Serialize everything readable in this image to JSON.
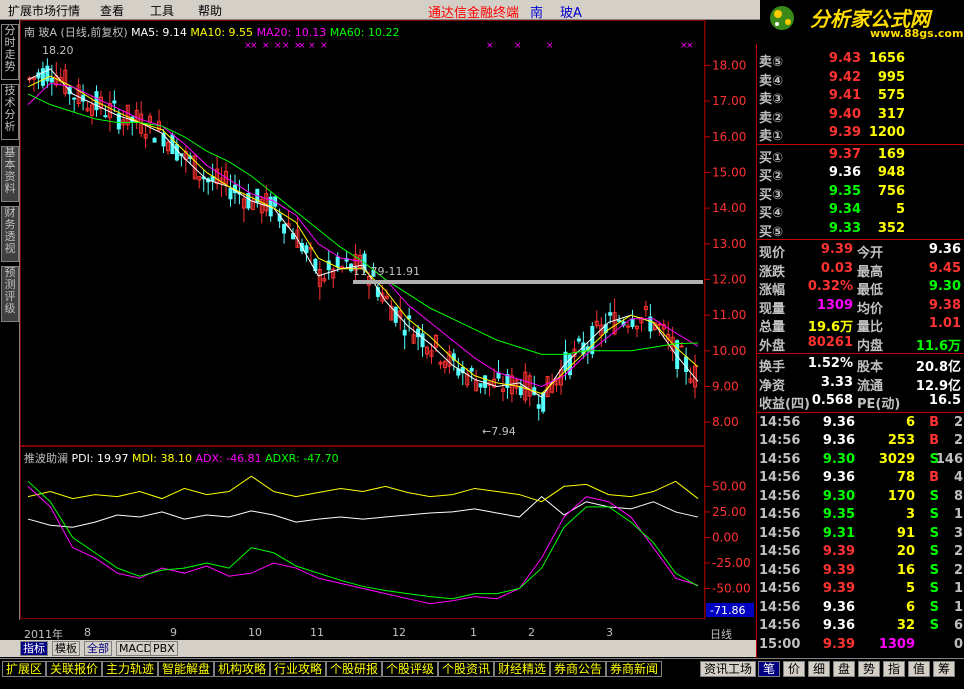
{
  "menu": {
    "items": [
      "扩展市场行情",
      "查看",
      "工具",
      "帮助"
    ],
    "title": "通达信金融终端",
    "stock_short": "南",
    "stock_name": "玻A"
  },
  "logo": {
    "text": "分析家公式网",
    "url": "www.88gs.com"
  },
  "left_tabs": [
    "分时走势",
    "技术分析",
    "基本资料",
    "财务透视",
    "预测评级"
  ],
  "main_header": {
    "stock": "南  玻A",
    "period": "(日线,前复权)",
    "ma5": "MA5: 9.14",
    "ma10": "MA10: 9.55",
    "ma20": "MA20: 10.13",
    "ma60": "MA60: 10.22",
    "high_mark": "18.20",
    "low_mark": "7.94",
    "range_label": "11.79-11.91"
  },
  "price_axis": [
    "18.00",
    "17.00",
    "16.00",
    "15.00",
    "14.00",
    "13.00",
    "12.00",
    "11.00",
    "10.00",
    "9.00",
    "8.00"
  ],
  "ind_header": {
    "name": "推波助澜",
    "pdi": "PDI: 19.97",
    "mdi": "MDI: 38.10",
    "adx": "ADX: -46.81",
    "adxr": "ADXR: -47.70"
  },
  "ind_axis": [
    "50.00",
    "25.00",
    "0.00",
    "-25.00",
    "-50.00"
  ],
  "ind_current": "-71.86",
  "date_axis": [
    "2011年",
    "8",
    "9",
    "10",
    "11",
    "12",
    "1",
    "2",
    "3"
  ],
  "period_button": "日线",
  "bottom_tabs": [
    "指标",
    "模板",
    "全部",
    "MACD",
    "PBX"
  ],
  "quotes": {
    "asks": [
      {
        "label": "卖⑤",
        "price": "9.43",
        "vol": "1656"
      },
      {
        "label": "卖④",
        "price": "9.42",
        "vol": "995"
      },
      {
        "label": "卖③",
        "price": "9.41",
        "vol": "575"
      },
      {
        "label": "卖②",
        "price": "9.40",
        "vol": "317"
      },
      {
        "label": "卖①",
        "price": "9.39",
        "vol": "1200"
      }
    ],
    "bids": [
      {
        "label": "买①",
        "price": "9.37",
        "vol": "169"
      },
      {
        "label": "买②",
        "price": "9.36",
        "vol": "948"
      },
      {
        "label": "买③",
        "price": "9.35",
        "vol": "756"
      },
      {
        "label": "买④",
        "price": "9.34",
        "vol": "5"
      },
      {
        "label": "买⑤",
        "price": "9.33",
        "vol": "352"
      }
    ],
    "stats": [
      {
        "l1": "现价",
        "v1": "9.39",
        "l2": "今开",
        "v2": "9.36"
      },
      {
        "l1": "涨跌",
        "v1": "0.03",
        "l2": "最高",
        "v2": "9.45"
      },
      {
        "l1": "涨幅",
        "v1": "0.32%",
        "l2": "最低",
        "v2": "9.30"
      },
      {
        "l1": "现量",
        "v1": "1309",
        "l2": "均价",
        "v2": "9.38"
      },
      {
        "l1": "总量",
        "v1": "19.6万",
        "l2": "量比",
        "v2": "1.01"
      },
      {
        "l1": "外盘",
        "v1": "80261",
        "l2": "内盘",
        "v2": "11.6万"
      }
    ],
    "stats2": [
      {
        "l1": "换手",
        "v1": "1.52%",
        "l2": "股本",
        "v2": "20.8亿"
      },
      {
        "l1": "净资",
        "v1": "3.33",
        "l2": "流通",
        "v2": "12.9亿"
      },
      {
        "l1": "收益(四)",
        "v1": "0.568",
        "l2": "PE(动)",
        "v2": "16.5"
      }
    ],
    "ticks": [
      {
        "time": "14:56",
        "price": "9.36",
        "vol": "6",
        "bs": "B",
        "n": "2"
      },
      {
        "time": "14:56",
        "price": "9.36",
        "vol": "253",
        "bs": "B",
        "n": "2"
      },
      {
        "time": "14:56",
        "price": "9.30",
        "vol": "3029",
        "bs": "S",
        "n": "146"
      },
      {
        "time": "14:56",
        "price": "9.36",
        "vol": "78",
        "bs": "B",
        "n": "4"
      },
      {
        "time": "14:56",
        "price": "9.30",
        "vol": "170",
        "bs": "S",
        "n": "8"
      },
      {
        "time": "14:56",
        "price": "9.35",
        "vol": "3",
        "bs": "S",
        "n": "1"
      },
      {
        "time": "14:56",
        "price": "9.31",
        "vol": "91",
        "bs": "S",
        "n": "3"
      },
      {
        "time": "14:56",
        "price": "9.39",
        "vol": "20",
        "bs": "S",
        "n": "2"
      },
      {
        "time": "14:56",
        "price": "9.39",
        "vol": "16",
        "bs": "S",
        "n": "2"
      },
      {
        "time": "14:56",
        "price": "9.39",
        "vol": "5",
        "bs": "S",
        "n": "1"
      },
      {
        "time": "14:56",
        "price": "9.36",
        "vol": "6",
        "bs": "S",
        "n": "1"
      },
      {
        "time": "14:56",
        "price": "9.36",
        "vol": "32",
        "bs": "S",
        "n": "6"
      },
      {
        "time": "15:00",
        "price": "9.39",
        "vol": "1309",
        "bs": "",
        "n": "0"
      }
    ]
  },
  "status_tabs": [
    "扩展区",
    "关联报价",
    "主力轨迹",
    "智能解盘",
    "机构攻略",
    "行业攻略",
    "个股研报",
    "个股评级",
    "个股资讯",
    "财经精选",
    "券商公告",
    "券商新闻"
  ],
  "right_status_tabs": [
    "资讯工场",
    "笔",
    "价",
    "细",
    "盘",
    "势",
    "指",
    "值",
    "筹"
  ],
  "colors": {
    "up": "#ff3232",
    "down": "#54ffff",
    "ma5": "#ffffff",
    "ma10": "#ffff00",
    "ma20": "#ff00ff",
    "ma60": "#00ff00",
    "grid": "#800000"
  },
  "chart_data": [
    {
      "type": "line",
      "title": "南 玻A (日线,前复权)",
      "ylim": [
        7.5,
        18.6
      ],
      "series": [
        {
          "name": "MA5",
          "values": [
            17.6,
            17.9,
            17.2,
            16.9,
            16.6,
            16.4,
            16.1,
            15.4,
            14.8,
            14.6,
            14.2,
            14.0,
            13.2,
            12.1,
            12.3,
            12.4,
            11.4,
            10.7,
            10.2,
            9.6,
            9.2,
            9.0,
            9.1,
            8.7,
            9.6,
            10.2,
            10.8,
            11.0,
            10.8,
            9.9,
            9.14
          ]
        },
        {
          "name": "MA10",
          "values": [
            17.4,
            17.7,
            17.4,
            17.0,
            16.7,
            16.4,
            16.2,
            15.6,
            15.0,
            14.6,
            14.3,
            14.0,
            13.6,
            12.6,
            12.3,
            12.3,
            11.7,
            10.9,
            10.4,
            9.8,
            9.3,
            9.1,
            9.0,
            8.8,
            9.4,
            10.0,
            10.6,
            11.0,
            10.8,
            10.1,
            9.55
          ]
        },
        {
          "name": "MA20",
          "values": [
            16.9,
            17.5,
            17.4,
            17.1,
            16.8,
            16.5,
            16.3,
            15.8,
            15.2,
            14.8,
            14.4,
            14.2,
            13.8,
            13.0,
            12.6,
            12.5,
            12.0,
            11.3,
            10.8,
            10.3,
            9.8,
            9.4,
            9.2,
            9.0,
            9.3,
            9.9,
            10.4,
            10.9,
            10.9,
            10.5,
            10.13
          ]
        },
        {
          "name": "MA60",
          "values": [
            17.2,
            16.9,
            16.7,
            16.5,
            16.4,
            16.4,
            16.3,
            16.0,
            15.6,
            15.3,
            14.9,
            14.4,
            13.9,
            13.4,
            12.9,
            12.5,
            12.0,
            11.6,
            11.2,
            10.9,
            10.6,
            10.3,
            10.1,
            9.9,
            9.9,
            10.0,
            10.0,
            10.0,
            10.1,
            10.2,
            10.22
          ]
        }
      ]
    },
    {
      "type": "line",
      "title": "推波助澜",
      "ylim": [
        -75,
        70
      ],
      "series": [
        {
          "name": "PDI",
          "values": [
            18,
            12,
            10,
            15,
            22,
            20,
            25,
            18,
            22,
            20,
            26,
            22,
            15,
            18,
            20,
            18,
            20,
            22,
            24,
            25,
            28,
            24,
            20,
            40,
            22,
            35,
            30,
            28,
            35,
            25,
            19.97
          ]
        },
        {
          "name": "MDI",
          "values": [
            40,
            45,
            38,
            42,
            40,
            45,
            38,
            48,
            42,
            45,
            60,
            45,
            40,
            44,
            48,
            45,
            50,
            44,
            40,
            42,
            48,
            45,
            42,
            35,
            50,
            52,
            42,
            40,
            45,
            55,
            38.1
          ]
        },
        {
          "name": "ADX",
          "values": [
            50,
            30,
            -10,
            -20,
            -35,
            -40,
            -30,
            -35,
            -28,
            -38,
            -35,
            -25,
            -30,
            -40,
            -45,
            -50,
            -55,
            -60,
            -65,
            -62,
            -58,
            -60,
            -50,
            -20,
            20,
            40,
            35,
            20,
            -10,
            -40,
            -46.81
          ]
        },
        {
          "name": "ADXR",
          "values": [
            55,
            35,
            0,
            -15,
            -30,
            -38,
            -32,
            -30,
            -25,
            -30,
            -10,
            -15,
            -28,
            -35,
            -42,
            -48,
            -52,
            -55,
            -58,
            -60,
            -55,
            -55,
            -50,
            -30,
            10,
            30,
            30,
            15,
            -5,
            -35,
            -47.7
          ]
        }
      ]
    }
  ]
}
